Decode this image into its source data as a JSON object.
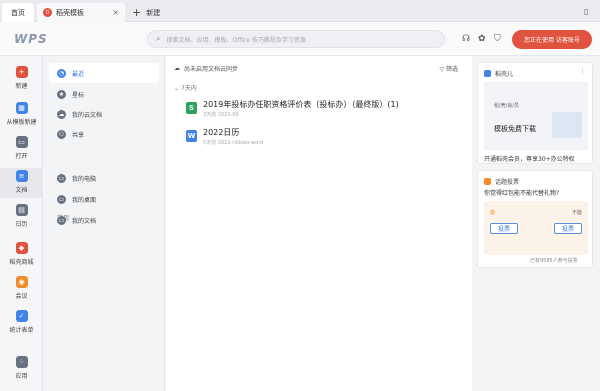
{
  "tabs": {
    "home": "首页",
    "template": "稻壳模板",
    "new": "新建"
  },
  "topbar": {
    "logo": "WPS",
    "search_placeholder": "搜索文档、应用、模板、Office 技巧教程及学习资源",
    "login_label": "您正在使用 访客账号"
  },
  "nav": [
    {
      "label": "新建",
      "icon": "plus-icon",
      "color": "#e0533e"
    },
    {
      "label": "从模板新建",
      "icon": "template-icon",
      "color": "#3f84e6"
    },
    {
      "label": "打开",
      "icon": "folder-icon",
      "color": "#6a7180"
    },
    {
      "label": "文档",
      "icon": "document-icon",
      "color": "#3f84e6"
    },
    {
      "label": "日历",
      "icon": "calendar-icon",
      "color": "#6a7180"
    },
    {
      "label": "稻壳商城",
      "icon": "store-icon",
      "color": "#e0533e"
    },
    {
      "label": "会议",
      "icon": "meeting-icon",
      "color": "#f08c2b"
    },
    {
      "label": "统计表单",
      "icon": "form-icon",
      "color": "#3f84e6"
    },
    {
      "label": "应用",
      "icon": "apps-icon",
      "color": "#6a7180"
    }
  ],
  "folders": {
    "items": [
      {
        "label": "最近",
        "icon": "clock-icon",
        "color": "#3f84e6"
      },
      {
        "label": "星标",
        "icon": "star-icon",
        "color": "#6a7180"
      },
      {
        "label": "我的云文档",
        "icon": "cloud-icon",
        "color": "#6a7180"
      },
      {
        "label": "共享",
        "icon": "share-icon",
        "color": "#6a7180"
      }
    ],
    "section": "常用",
    "common": [
      {
        "label": "我的电脑",
        "icon": "computer-icon",
        "color": "#6a7180"
      },
      {
        "label": "我的桌面",
        "icon": "desktop-icon",
        "color": "#6a7180"
      },
      {
        "label": "我的文档",
        "icon": "docs-folder-icon",
        "color": "#6a7180"
      }
    ]
  },
  "main": {
    "cloud_sync": "尚未启用文档云同步",
    "filter": "筛选",
    "group_label": "7天内",
    "files": [
      {
        "name": "2019年投标办任职资格评价表（投标办）（最终版）(1)",
        "time": "3天前",
        "path": "2021-06",
        "type": "S",
        "color": "#2aa35b"
      },
      {
        "name": "2022日历",
        "time": "5天前",
        "path": "2022-rilibiao-word",
        "type": "W",
        "color": "#3f84e6"
      }
    ]
  },
  "right": {
    "card1_title": "稻壳儿",
    "banner_line1": "稻/壳/会/员",
    "banner_title": "模板免费下载",
    "card1_footer": "开通稻壳会员，尊享30+办公特权",
    "card2_title": "话题投票",
    "card2_question": "你觉得红包能不能代替礼物?",
    "vote_yes_label": "能",
    "vote_no_label": "不能",
    "vote_yes_button": "投票",
    "vote_no_button": "投票",
    "vote_count": "已有9585人参与投票"
  }
}
